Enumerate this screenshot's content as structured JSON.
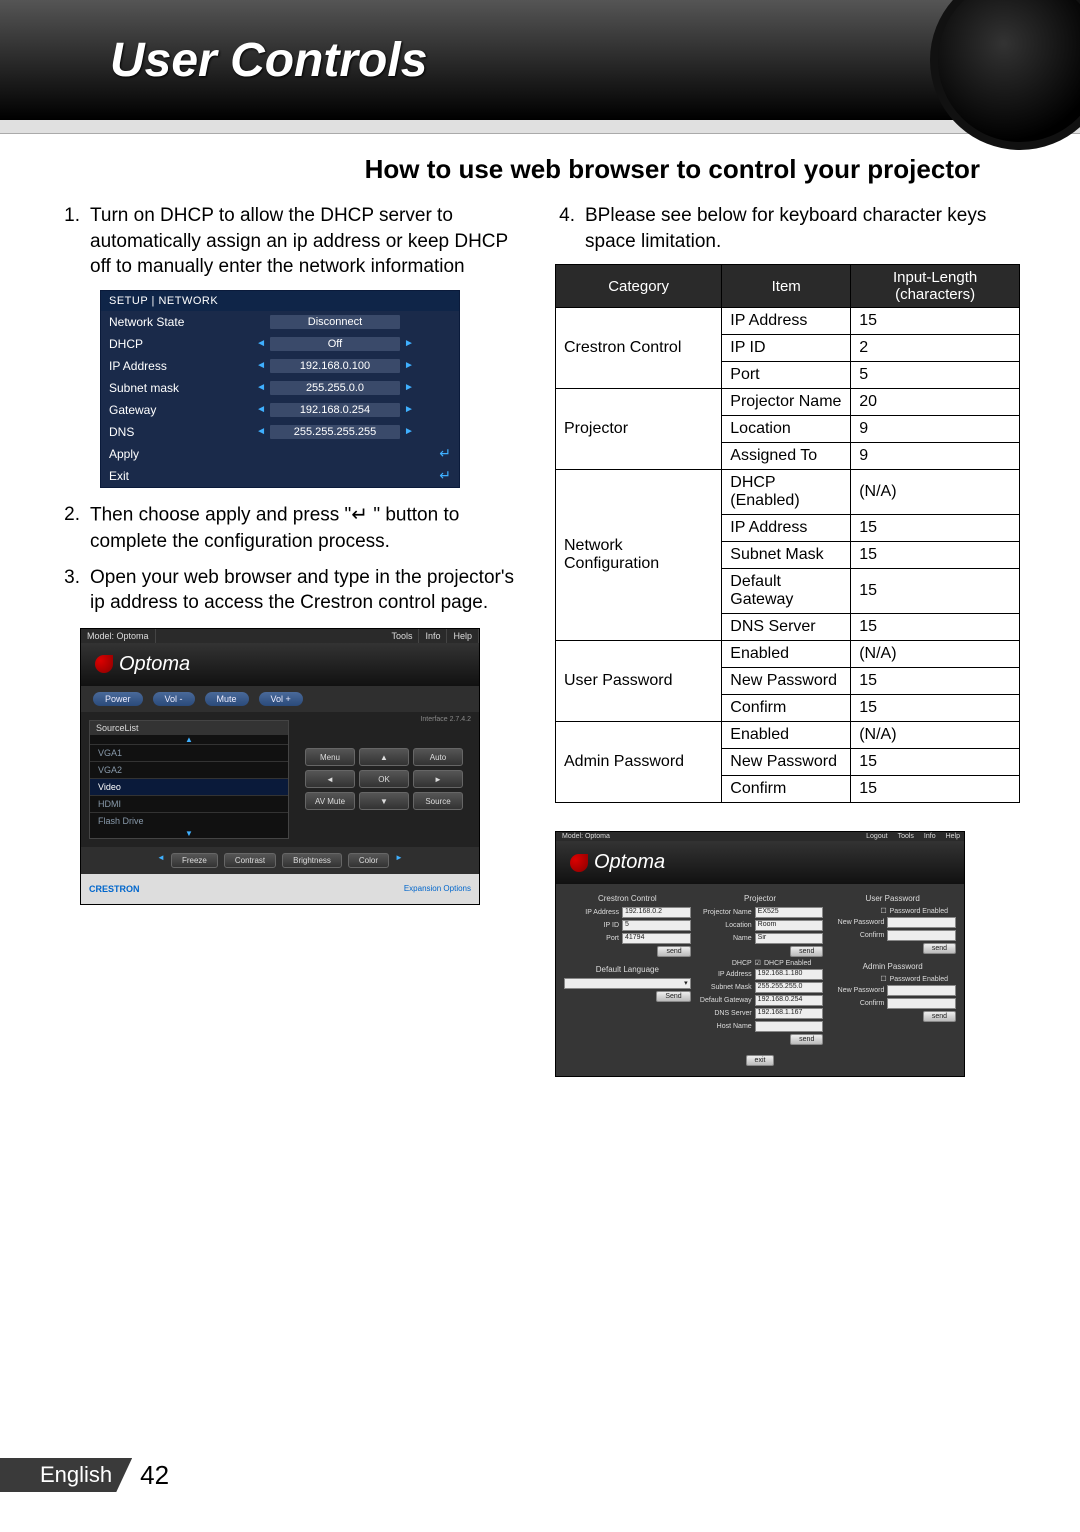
{
  "page_title": "User Controls",
  "section_title": "How to use web browser to control your projector",
  "steps_left": [
    {
      "num": "1.",
      "text": "Turn on DHCP to allow the DHCP server to automatically assign an ip address or keep DHCP off to manually enter the network information"
    },
    {
      "num": "2.",
      "text_before": "Then choose apply and press \"",
      "text_after": " \" button to complete the configuration process."
    },
    {
      "num": "3.",
      "text": "Open your web browser and type in the projector's ip address to access the Crestron control page."
    }
  ],
  "step_right": {
    "num": "4.",
    "text": "BPlease see below for keyboard character keys space limitation."
  },
  "osd": {
    "header": "SETUP  |  NETWORK",
    "rows": [
      {
        "label": "Network State",
        "value": "Disconnect",
        "arrows": false
      },
      {
        "label": "DHCP",
        "value": "Off",
        "arrows": true
      },
      {
        "label": "IP Address",
        "value": "192.168.0.100",
        "arrows": true
      },
      {
        "label": "Subnet mask",
        "value": "255.255.0.0",
        "arrows": true
      },
      {
        "label": "Gateway",
        "value": "192.168.0.254",
        "arrows": true
      },
      {
        "label": "DNS",
        "value": "255.255.255.255",
        "arrows": true
      },
      {
        "label": "Apply",
        "value": "",
        "enter": true
      },
      {
        "label": "Exit",
        "value": "",
        "enter": true
      }
    ]
  },
  "limit_table": {
    "headers": [
      "Category",
      "Item",
      "Input-Length (characters)"
    ],
    "rows": [
      {
        "cat": "Crestron Control",
        "item": "IP Address",
        "len": "15",
        "rowspan": 3,
        "first": true
      },
      {
        "item": "IP ID",
        "len": "2"
      },
      {
        "item": "Port",
        "len": "5"
      },
      {
        "cat": "Projector",
        "item": "Projector Name",
        "len": "20",
        "rowspan": 3,
        "first": true
      },
      {
        "item": "Location",
        "len": "9"
      },
      {
        "item": "Assigned To",
        "len": "9"
      },
      {
        "cat": "Network Configuration",
        "item": "DHCP (Enabled)",
        "len": "(N/A)",
        "rowspan": 5,
        "first": true
      },
      {
        "item": "IP Address",
        "len": "15"
      },
      {
        "item": "Subnet Mask",
        "len": "15"
      },
      {
        "item": "Default Gateway",
        "len": "15"
      },
      {
        "item": "DNS Server",
        "len": "15"
      },
      {
        "cat": "User Password",
        "item": "Enabled",
        "len": "(N/A)",
        "rowspan": 3,
        "first": true
      },
      {
        "item": "New Password",
        "len": "15"
      },
      {
        "item": "Confirm",
        "len": "15"
      },
      {
        "cat": "Admin Password",
        "item": "Enabled",
        "len": "(N/A)",
        "rowspan": 3,
        "first": true
      },
      {
        "item": "New Password",
        "len": "15"
      },
      {
        "item": "Confirm",
        "len": "15"
      }
    ]
  },
  "crestron1": {
    "model": "Model: Optoma",
    "tabs": [
      "Tools",
      "Info",
      "Help"
    ],
    "brand": "Optoma",
    "top_buttons": [
      "Power",
      "Vol -",
      "Mute",
      "Vol +"
    ],
    "interface": "Interface 2.7.4.2",
    "source_header": "SourceList",
    "sources": [
      "VGA1",
      "VGA2",
      "Video",
      "HDMI",
      "Flash Drive"
    ],
    "dpad": {
      "menu": "Menu",
      "auto": "Auto",
      "ok": "OK",
      "avmute": "AV Mute",
      "source": "Source"
    },
    "bottom_buttons": [
      "Freeze",
      "Contrast",
      "Brightness",
      "Color"
    ],
    "footer_logo": "CRESTRON",
    "footer_link": "Expansion Options"
  },
  "tools": {
    "model": "Model: Optoma",
    "tabs_right": [
      "Logout",
      "Tools",
      "Info",
      "Help"
    ],
    "brand": "Optoma",
    "col1_h": "Crestron Control",
    "col2_h": "Projector",
    "col3_h": "User Password",
    "col4_h": "Admin Password",
    "col1": [
      {
        "lbl": "IP Address",
        "val": "192.168.0.2"
      },
      {
        "lbl": "IP ID",
        "val": "5"
      },
      {
        "lbl": "Port",
        "val": "41794"
      }
    ],
    "col1_send": "send",
    "default_lang_h": "Default Language",
    "default_lang_send": "Send",
    "col2": [
      {
        "lbl": "Projector Name",
        "val": "EX525"
      },
      {
        "lbl": "Location",
        "val": "Room"
      },
      {
        "lbl": "Name",
        "val": "Sir"
      }
    ],
    "col2_send": "send",
    "dhcp_lbl": "DHCP",
    "dhcp_txt": "DHCP Enabled",
    "net": [
      {
        "lbl": "IP Address",
        "val": "192.168.1.180"
      },
      {
        "lbl": "Subnet Mask",
        "val": "255.255.255.0"
      },
      {
        "lbl": "Default Gateway",
        "val": "192.168.0.254"
      },
      {
        "lbl": "DNS Server",
        "val": "192.168.1.167"
      },
      {
        "lbl": "Host Name",
        "val": ""
      }
    ],
    "net_send": "send",
    "pw_enabled": "Password Enabled",
    "user_pw": [
      {
        "lbl": "New Password",
        "val": ""
      },
      {
        "lbl": "Confirm",
        "val": ""
      }
    ],
    "user_send": "send",
    "admin_pw": [
      {
        "lbl": "New Password",
        "val": ""
      },
      {
        "lbl": "Confirm",
        "val": ""
      }
    ],
    "admin_send": "send",
    "exit": "exit"
  },
  "footer": {
    "lang": "English",
    "page": "42"
  }
}
